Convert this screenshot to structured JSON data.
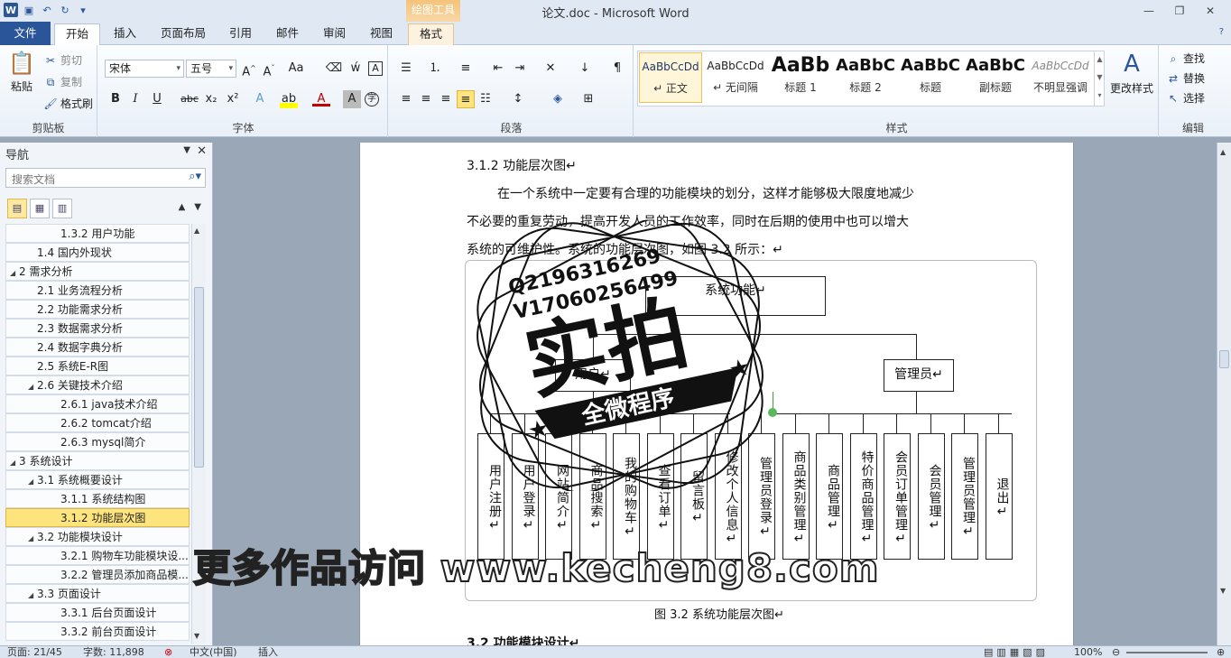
{
  "window": {
    "title": "论文.doc - Microsoft Word",
    "context_tool_header": "绘图工具"
  },
  "tabs": [
    "文件",
    "开始",
    "插入",
    "页面布局",
    "引用",
    "邮件",
    "审阅",
    "视图",
    "格式"
  ],
  "ribbon": {
    "clipboard": {
      "label": "剪贴板",
      "paste": "粘贴",
      "cut": "剪切",
      "copy": "复制",
      "format_painter": "格式刷"
    },
    "font": {
      "label": "字体",
      "font_name": "宋体",
      "font_size": "五号"
    },
    "paragraph": {
      "label": "段落"
    },
    "styles": {
      "label": "样式",
      "items": [
        {
          "sample": "AaBbCcDd",
          "name": "↵ 正文"
        },
        {
          "sample": "AaBbCcDd",
          "name": "↵ 无间隔"
        },
        {
          "sample": "AaBb",
          "name": "标题 1"
        },
        {
          "sample": "AaBbC",
          "name": "标题 2"
        },
        {
          "sample": "AaBbC",
          "name": "标题"
        },
        {
          "sample": "AaBbC",
          "name": "副标题"
        },
        {
          "sample": "AaBbCcDd",
          "name": "不明显强调"
        }
      ],
      "change_styles": "更改样式"
    },
    "editing": {
      "label": "编辑",
      "find": "查找",
      "replace": "替换",
      "select": "选择"
    }
  },
  "nav": {
    "title": "导航",
    "search_placeholder": "搜索文档",
    "items": [
      {
        "text": "1.3.2  用户功能",
        "level": 3,
        "tri": ""
      },
      {
        "text": "1.4  国内外现状",
        "level": 2,
        "tri": ""
      },
      {
        "text": "2  需求分析",
        "level": 1,
        "tri": "◢"
      },
      {
        "text": "2.1  业务流程分析",
        "level": 2,
        "tri": ""
      },
      {
        "text": "2.2  功能需求分析",
        "level": 2,
        "tri": ""
      },
      {
        "text": "2.3  数据需求分析",
        "level": 2,
        "tri": ""
      },
      {
        "text": "2.4  数据字典分析",
        "level": 2,
        "tri": ""
      },
      {
        "text": "2.5  系统E-R图",
        "level": 2,
        "tri": ""
      },
      {
        "text": "2.6   关键技术介绍",
        "level": 2,
        "tri": "◢"
      },
      {
        "text": "2.6.1  java技术介绍",
        "level": 3,
        "tri": ""
      },
      {
        "text": "2.6.2  tomcat介绍",
        "level": 3,
        "tri": ""
      },
      {
        "text": "2.6.3  mysql简介",
        "level": 3,
        "tri": ""
      },
      {
        "text": "3  系统设计",
        "level": 1,
        "tri": "◢"
      },
      {
        "text": "3.1  系统概要设计",
        "level": 2,
        "tri": "◢"
      },
      {
        "text": "3.1.1  系统结构图",
        "level": 3,
        "tri": ""
      },
      {
        "text": "3.1.2  功能层次图",
        "level": 3,
        "tri": "",
        "selected": true
      },
      {
        "text": "3.2  功能模块设计",
        "level": 2,
        "tri": "◢"
      },
      {
        "text": "3.2.1  购物车功能模块设...",
        "level": 3,
        "tri": ""
      },
      {
        "text": "3.2.2  管理员添加商品模...",
        "level": 3,
        "tri": ""
      },
      {
        "text": "3.3  页面设计",
        "level": 2,
        "tri": "◢"
      },
      {
        "text": "3.3.1  后台页面设计",
        "level": 3,
        "tri": ""
      },
      {
        "text": "3.3.2  前台页面设计",
        "level": 3,
        "tri": ""
      }
    ]
  },
  "document": {
    "heading": "3.1.2   功能层次图↵",
    "para_line1": "在一个系统中一定要有合理的功能模块的划分，这样才能够极大限度地减少",
    "para_line2": "不必要的重复劳动，提高开发人员的工作效率，同时在后期的使用中也可以增大",
    "para_line3": "系统的可维护性。系统的功能层次图，如图 3.2 所示：↵",
    "next_heading": "3.2   功能模块设计↵",
    "diagram": {
      "root": "系统功能↵",
      "user_node": "用户↵",
      "admin_node": "管理员↵",
      "user_children": [
        "用户注册↵",
        "用户登录↵",
        "网站简介↵",
        "商品搜索↵",
        "我的购物车↵",
        "查看订单↵",
        "留言板↵",
        "修改个人信息↵"
      ],
      "admin_children": [
        "管理员登录↵",
        "商品类别管理↵",
        "商品管理↵",
        "特价商品管理↵",
        "会员订单管理↵",
        "会员管理↵",
        "管理员管理↵",
        "退出↵"
      ]
    },
    "caption": "图 3.2  系统功能层次图↵"
  },
  "watermark": {
    "qq": "Q2196316269",
    "wechat": "V17060256499",
    "main": "实拍",
    "ribbon": "全微程序",
    "bottom_banner": "更多作品访问 www.kecheng8.com"
  },
  "status": {
    "page": "页面: 21/45",
    "words": "字数: 11,898",
    "language": "中文(中国)",
    "insert": "插入",
    "zoom": "100%"
  }
}
